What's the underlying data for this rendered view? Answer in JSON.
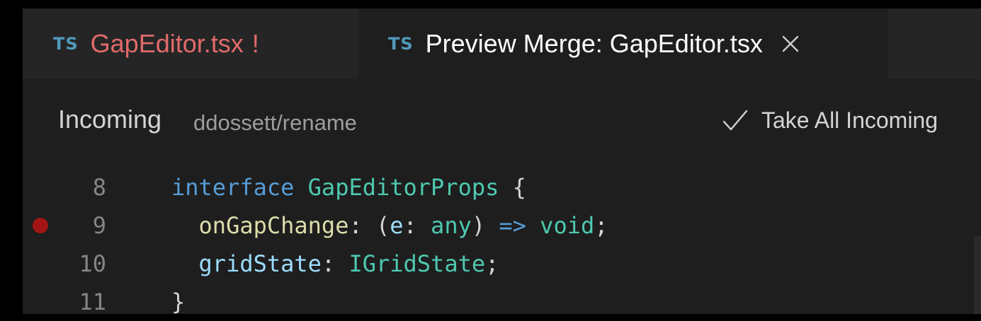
{
  "tabs": [
    {
      "icon": "TS",
      "label": "GapEditor.tsx",
      "dirty_marker": "!"
    },
    {
      "icon": "TS",
      "label": "Preview Merge: GapEditor.tsx",
      "close_glyph": "×"
    }
  ],
  "merge_header": {
    "title": "Incoming",
    "branch": "ddossett/rename",
    "action_label": "Take All Incoming"
  },
  "code": {
    "lines": [
      {
        "number": "8",
        "breakpoint": false,
        "tokens": [
          "interface",
          " ",
          "GapEditorProps",
          " {"
        ]
      },
      {
        "number": "9",
        "breakpoint": true,
        "tokens": [
          "  ",
          "onGapChange",
          ": (",
          "e",
          ": ",
          "any",
          ") ",
          "=>",
          " ",
          "void",
          ";"
        ]
      },
      {
        "number": "10",
        "breakpoint": false,
        "tokens": [
          "  ",
          "gridState",
          ": ",
          "IGridState",
          ";"
        ]
      },
      {
        "number": "11",
        "breakpoint": false,
        "tokens": [
          "}"
        ]
      }
    ]
  },
  "colors": {
    "error_tab": "#e26a6a",
    "ts_icon": "#519aba",
    "breakpoint": "#a31515",
    "keyword": "#569cd6",
    "type": "#4ec9b0",
    "property": "#9cdcfe",
    "function": "#dcdcaa"
  }
}
